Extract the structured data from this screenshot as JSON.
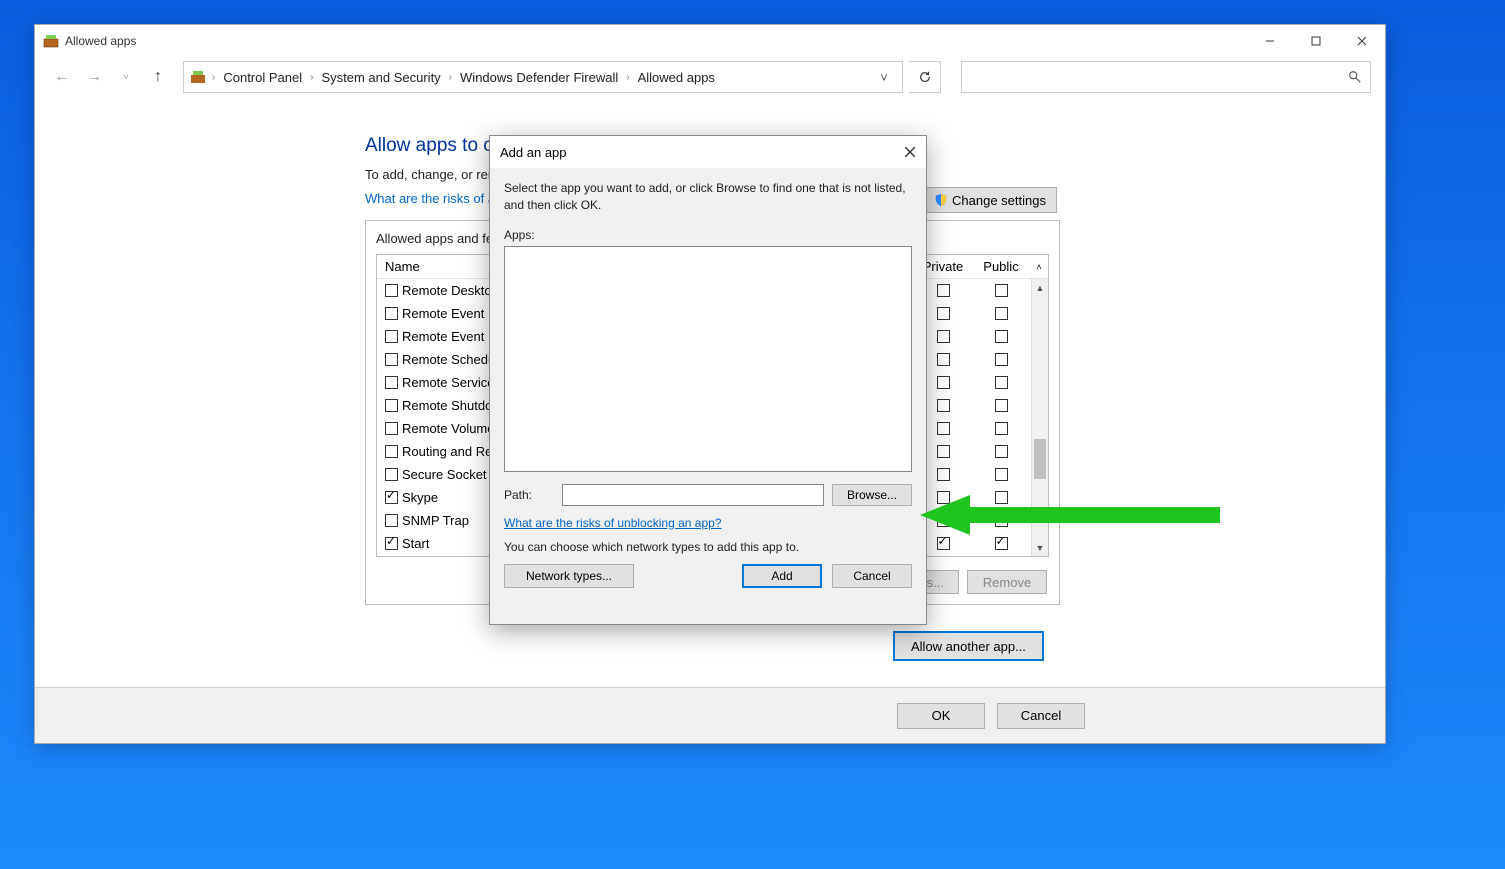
{
  "window": {
    "title": "Allowed apps",
    "breadcrumbs": [
      "Control Panel",
      "System and Security",
      "Windows Defender Firewall",
      "Allowed apps"
    ]
  },
  "page": {
    "heading": "Allow apps to communicate through Windows Defender Firewall",
    "subtext": "To add, change, or remove allowed apps and ports, click Change settings.",
    "risks_link": "What are the risks of allowing an app to communicate?",
    "change_settings": "Change settings",
    "legend": "Allowed apps and features:",
    "columns": {
      "name": "Name",
      "private": "Private",
      "public": "Public"
    },
    "rows": [
      {
        "name": "Remote Desktop",
        "name_checked": false,
        "private": false,
        "public": false
      },
      {
        "name": "Remote Event Log Management",
        "name_checked": false,
        "private": false,
        "public": false
      },
      {
        "name": "Remote Event Monitor",
        "name_checked": false,
        "private": false,
        "public": false
      },
      {
        "name": "Remote Scheduled Tasks Management",
        "name_checked": false,
        "private": false,
        "public": false
      },
      {
        "name": "Remote Service Management",
        "name_checked": false,
        "private": false,
        "public": false
      },
      {
        "name": "Remote Shutdown",
        "name_checked": false,
        "private": false,
        "public": false
      },
      {
        "name": "Remote Volume Management",
        "name_checked": false,
        "private": false,
        "public": false
      },
      {
        "name": "Routing and Remote Access",
        "name_checked": false,
        "private": false,
        "public": false
      },
      {
        "name": "Secure Socket Tunneling Protocol",
        "name_checked": false,
        "private": false,
        "public": false
      },
      {
        "name": "Skype",
        "name_checked": true,
        "private": false,
        "public": false
      },
      {
        "name": "SNMP Trap",
        "name_checked": false,
        "private": false,
        "public": false
      },
      {
        "name": "Start",
        "name_checked": true,
        "private": true,
        "public": true
      }
    ],
    "details_btn": "Details...",
    "remove_btn": "Remove",
    "allow_another": "Allow another app...",
    "ok": "OK",
    "cancel": "Cancel"
  },
  "dialog": {
    "title": "Add an app",
    "instruction": "Select the app you want to add, or click Browse to find one that is not listed, and then click OK.",
    "apps_label": "Apps:",
    "path_label": "Path:",
    "path_value": "",
    "browse": "Browse...",
    "risks_link": "What are the risks of unblocking an app?",
    "network_desc": "You can choose which network types to add this app to.",
    "network_types": "Network types...",
    "add": "Add",
    "cancel": "Cancel"
  }
}
